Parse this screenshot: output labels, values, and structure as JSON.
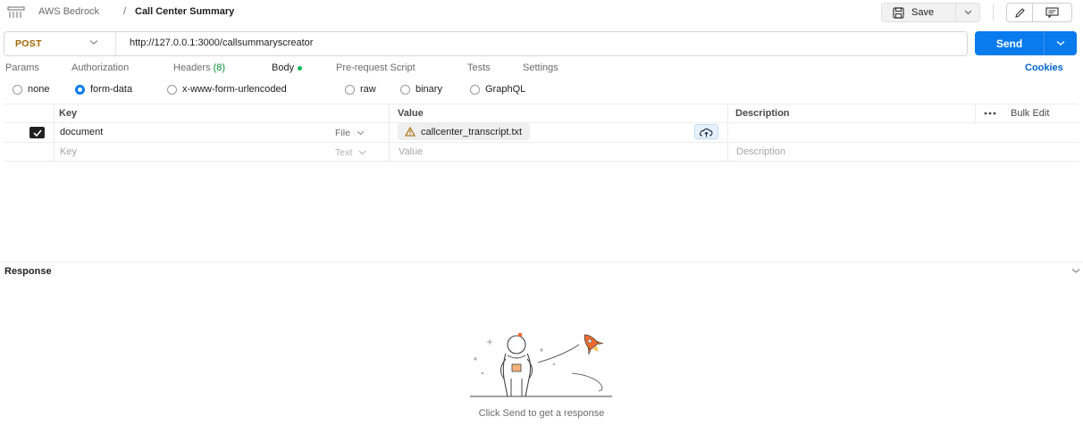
{
  "breadcrumb": {
    "workspace": "AWS Bedrock",
    "separator": "/",
    "request_name": "Call Center Summary",
    "app_icon": "http-request-icon"
  },
  "toolbar": {
    "save_label": "Save",
    "save_icon": "save-icon",
    "edit_icon": "pencil-icon",
    "docs_icon": "comment-icon"
  },
  "request": {
    "method": "POST",
    "url": "http://127.0.0.1:3000/callsummaryscreator",
    "send_label": "Send"
  },
  "tabs": [
    {
      "label": "Params"
    },
    {
      "label": "Authorization"
    },
    {
      "label": "Headers",
      "count": "(8)"
    },
    {
      "label": "Body",
      "active": true
    },
    {
      "label": "Pre-request Script"
    },
    {
      "label": "Tests"
    },
    {
      "label": "Settings"
    }
  ],
  "cookies_label": "Cookies",
  "body_types": [
    {
      "label": "none",
      "selected": false
    },
    {
      "label": "form-data",
      "selected": true
    },
    {
      "label": "x-www-form-urlencoded",
      "selected": false
    },
    {
      "label": "raw",
      "selected": false
    },
    {
      "label": "binary",
      "selected": false
    },
    {
      "label": "GraphQL",
      "selected": false
    }
  ],
  "form_table": {
    "headers": {
      "key": "Key",
      "value": "Value",
      "description": "Description"
    },
    "more_icon": "more-horizontal-icon",
    "bulk_edit_label": "Bulk Edit",
    "rows": [
      {
        "checked": true,
        "key": "document",
        "type": "File",
        "value_file": "callcenter_transcript.txt",
        "warning_icon": "warning-icon",
        "upload_icon": "cloud-upload-icon"
      }
    ],
    "placeholder_row": {
      "key": "Key",
      "type": "Text",
      "value": "Value",
      "description": "Description"
    }
  },
  "response": {
    "title": "Response",
    "empty_hint": "Click Send to get a response",
    "illustration": "astronaut-rocket-illustration"
  },
  "colors": {
    "accent": "#097bed",
    "method_post": "#a36300",
    "link": "#0265d2",
    "body_dot": "#0cbb52"
  }
}
